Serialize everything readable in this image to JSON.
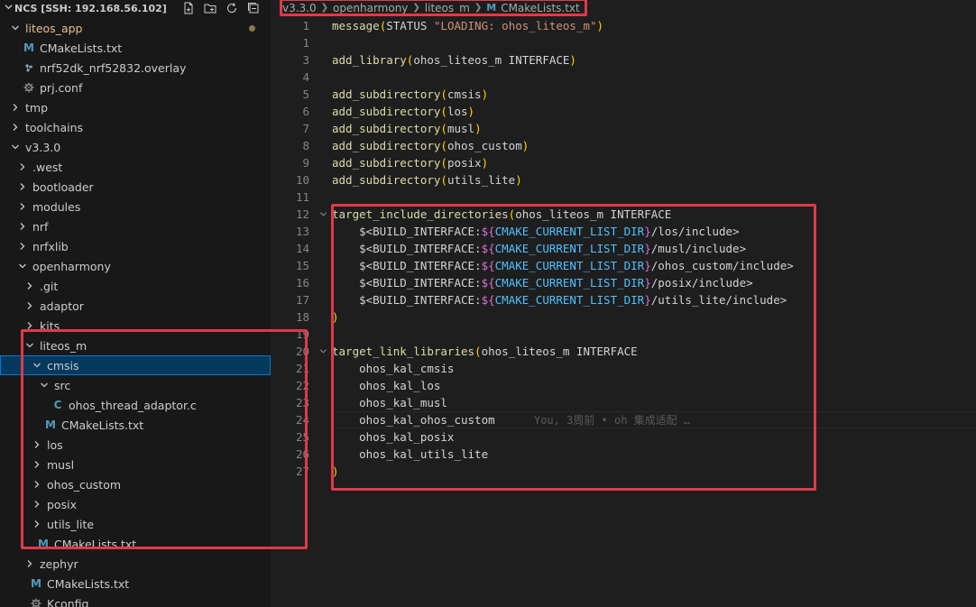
{
  "sidebar": {
    "title": "NCS [SSH: 192.168.56.102]",
    "actions": [
      {
        "icon": "new-file-icon"
      },
      {
        "icon": "new-folder-icon"
      },
      {
        "icon": "refresh-icon"
      },
      {
        "icon": "collapse-all-icon"
      }
    ],
    "tree": [
      {
        "label": "liteos_app",
        "type": "folder",
        "expanded": true,
        "depth": 0,
        "git": true
      },
      {
        "label": "CMakeLists.txt",
        "type": "cmake",
        "depth": 1
      },
      {
        "label": "nrf52dk_nrf52832.overlay",
        "type": "overlay",
        "depth": 1
      },
      {
        "label": "prj.conf",
        "type": "gear",
        "depth": 1
      },
      {
        "label": "tmp",
        "type": "folder",
        "expanded": false,
        "depth": 0
      },
      {
        "label": "toolchains",
        "type": "folder",
        "expanded": false,
        "depth": 0
      },
      {
        "label": "v3.3.0",
        "type": "folder",
        "expanded": true,
        "depth": 0
      },
      {
        "label": ".west",
        "type": "folder",
        "expanded": false,
        "depth": 1
      },
      {
        "label": "bootloader",
        "type": "folder",
        "expanded": false,
        "depth": 1
      },
      {
        "label": "modules",
        "type": "folder",
        "expanded": false,
        "depth": 1
      },
      {
        "label": "nrf",
        "type": "folder",
        "expanded": false,
        "depth": 1
      },
      {
        "label": "nrfxlib",
        "type": "folder",
        "expanded": false,
        "depth": 1
      },
      {
        "label": "openharmony",
        "type": "folder",
        "expanded": true,
        "depth": 1
      },
      {
        "label": ".git",
        "type": "folder",
        "expanded": false,
        "depth": 2
      },
      {
        "label": "adaptor",
        "type": "folder",
        "expanded": false,
        "depth": 2
      },
      {
        "label": "kits",
        "type": "folder",
        "expanded": false,
        "depth": 2
      },
      {
        "label": "liteos_m",
        "type": "folder",
        "expanded": true,
        "depth": 2
      },
      {
        "label": "cmsis",
        "type": "folder",
        "expanded": true,
        "depth": 3,
        "selected": true
      },
      {
        "label": "src",
        "type": "folder",
        "expanded": true,
        "depth": 4
      },
      {
        "label": "ohos_thread_adaptor.c",
        "type": "c",
        "depth": 5
      },
      {
        "label": "CMakeLists.txt",
        "type": "cmake",
        "depth": 4
      },
      {
        "label": "los",
        "type": "folder",
        "expanded": false,
        "depth": 3
      },
      {
        "label": "musl",
        "type": "folder",
        "expanded": false,
        "depth": 3
      },
      {
        "label": "ohos_custom",
        "type": "folder",
        "expanded": false,
        "depth": 3
      },
      {
        "label": "posix",
        "type": "folder",
        "expanded": false,
        "depth": 3
      },
      {
        "label": "utils_lite",
        "type": "folder",
        "expanded": false,
        "depth": 3
      },
      {
        "label": "CMakeLists.txt",
        "type": "cmake",
        "depth": 3
      },
      {
        "label": "zephyr",
        "type": "folder",
        "expanded": false,
        "depth": 2
      },
      {
        "label": "CMakeLists.txt",
        "type": "cmake",
        "depth": 2
      },
      {
        "label": "Kconfig",
        "type": "gear",
        "depth": 2
      }
    ]
  },
  "breadcrumb": {
    "items": [
      "v3.3.0",
      "openharmony",
      "liteos_m"
    ],
    "file": "CMakeLists.txt"
  },
  "editor": {
    "lines": [
      {
        "n": "1",
        "tokens": [
          [
            "fn",
            "message"
          ],
          [
            "p1",
            "("
          ],
          [
            "pl",
            "STATUS "
          ],
          [
            "str",
            "\"LOADING: ohos_liteos_m\""
          ],
          [
            "p1",
            ")"
          ]
        ]
      },
      {
        "n": "1",
        "tokens": []
      },
      {
        "n": "3",
        "tokens": [
          [
            "fn",
            "add_library"
          ],
          [
            "p1",
            "("
          ],
          [
            "pl",
            "ohos_liteos_m INTERFACE"
          ],
          [
            "p1",
            ")"
          ]
        ]
      },
      {
        "n": "4",
        "tokens": []
      },
      {
        "n": "5",
        "tokens": [
          [
            "fn",
            "add_subdirectory"
          ],
          [
            "p1",
            "("
          ],
          [
            "pl",
            "cmsis"
          ],
          [
            "p1",
            ")"
          ]
        ]
      },
      {
        "n": "6",
        "tokens": [
          [
            "fn",
            "add_subdirectory"
          ],
          [
            "p1",
            "("
          ],
          [
            "pl",
            "los"
          ],
          [
            "p1",
            ")"
          ]
        ]
      },
      {
        "n": "7",
        "tokens": [
          [
            "fn",
            "add_subdirectory"
          ],
          [
            "p1",
            "("
          ],
          [
            "pl",
            "musl"
          ],
          [
            "p1",
            ")"
          ]
        ]
      },
      {
        "n": "8",
        "tokens": [
          [
            "fn",
            "add_subdirectory"
          ],
          [
            "p1",
            "("
          ],
          [
            "pl",
            "ohos_custom"
          ],
          [
            "p1",
            ")"
          ]
        ]
      },
      {
        "n": "9",
        "tokens": [
          [
            "fn",
            "add_subdirectory"
          ],
          [
            "p1",
            "("
          ],
          [
            "pl",
            "posix"
          ],
          [
            "p1",
            ")"
          ]
        ]
      },
      {
        "n": "10",
        "tokens": [
          [
            "fn",
            "add_subdirectory"
          ],
          [
            "p1",
            "("
          ],
          [
            "pl",
            "utils_lite"
          ],
          [
            "p1",
            ")"
          ]
        ]
      },
      {
        "n": "11",
        "tokens": []
      },
      {
        "n": "12",
        "fold": true,
        "tokens": [
          [
            "fn",
            "target_include_directories"
          ],
          [
            "p1",
            "("
          ],
          [
            "pl",
            "ohos_liteos_m INTERFACE"
          ]
        ]
      },
      {
        "n": "13",
        "tokens": [
          [
            "pl",
            "    $<BUILD_INTERFACE:"
          ],
          [
            "p2",
            "${"
          ],
          [
            "var",
            "CMAKE_CURRENT_LIST_DIR"
          ],
          [
            "p2",
            "}"
          ],
          [
            "pl",
            "/los/include>"
          ]
        ]
      },
      {
        "n": "14",
        "tokens": [
          [
            "pl",
            "    $<BUILD_INTERFACE:"
          ],
          [
            "p2",
            "${"
          ],
          [
            "var",
            "CMAKE_CURRENT_LIST_DIR"
          ],
          [
            "p2",
            "}"
          ],
          [
            "pl",
            "/musl/include>"
          ]
        ]
      },
      {
        "n": "15",
        "tokens": [
          [
            "pl",
            "    $<BUILD_INTERFACE:"
          ],
          [
            "p2",
            "${"
          ],
          [
            "var",
            "CMAKE_CURRENT_LIST_DIR"
          ],
          [
            "p2",
            "}"
          ],
          [
            "pl",
            "/ohos_custom/include>"
          ]
        ]
      },
      {
        "n": "16",
        "tokens": [
          [
            "pl",
            "    $<BUILD_INTERFACE:"
          ],
          [
            "p2",
            "${"
          ],
          [
            "var",
            "CMAKE_CURRENT_LIST_DIR"
          ],
          [
            "p2",
            "}"
          ],
          [
            "pl",
            "/posix/include>"
          ]
        ]
      },
      {
        "n": "17",
        "tokens": [
          [
            "pl",
            "    $<BUILD_INTERFACE:"
          ],
          [
            "p2",
            "${"
          ],
          [
            "var",
            "CMAKE_CURRENT_LIST_DIR"
          ],
          [
            "p2",
            "}"
          ],
          [
            "pl",
            "/utils_lite/include>"
          ]
        ]
      },
      {
        "n": "18",
        "tokens": [
          [
            "p1",
            ")"
          ]
        ]
      },
      {
        "n": "19",
        "tokens": []
      },
      {
        "n": "20",
        "fold": true,
        "tokens": [
          [
            "fn",
            "target_link_libraries"
          ],
          [
            "p1",
            "("
          ],
          [
            "pl",
            "ohos_liteos_m INTERFACE"
          ]
        ]
      },
      {
        "n": "21",
        "tokens": [
          [
            "pl",
            "    ohos_kal_cmsis"
          ]
        ]
      },
      {
        "n": "22",
        "tokens": [
          [
            "pl",
            "    ohos_kal_los"
          ]
        ]
      },
      {
        "n": "23",
        "tokens": [
          [
            "pl",
            "    ohos_kal_musl"
          ]
        ]
      },
      {
        "n": "24",
        "current": true,
        "tokens": [
          [
            "pl",
            "    ohos_kal_ohos_custom"
          ]
        ],
        "blame": "You, 3周前 • oh 集成适配 …"
      },
      {
        "n": "25",
        "tokens": [
          [
            "pl",
            "    ohos_kal_posix"
          ]
        ]
      },
      {
        "n": "26",
        "tokens": [
          [
            "pl",
            "    ohos_kal_utils_lite"
          ]
        ]
      },
      {
        "n": "27",
        "tokens": [
          [
            "p1",
            ")"
          ]
        ]
      }
    ]
  },
  "colors": {
    "annotation_red": "#e03a48",
    "selection": "#04395e",
    "function": "#dcdcaa",
    "string": "#ce9178",
    "variable": "#4fc1ff"
  }
}
